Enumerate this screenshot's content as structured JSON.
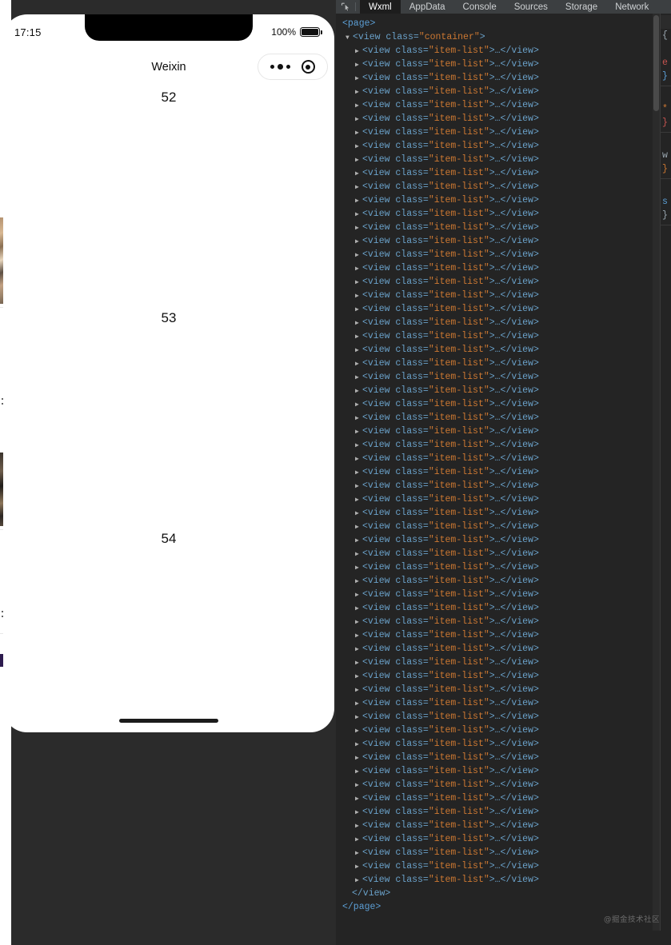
{
  "simulator": {
    "status_bar": {
      "time": "17:15",
      "battery_percent": "100%",
      "battery_icon": "battery-full-icon"
    },
    "navbar": {
      "title": "Weixin",
      "capsule": {
        "menu_icon": "more-dots-icon",
        "target_icon": "target-circle-icon"
      }
    },
    "page": {
      "items": [
        {
          "label": "52"
        },
        {
          "label": "53"
        },
        {
          "label": "54"
        }
      ]
    },
    "home_indicator": "home-indicator"
  },
  "devtools": {
    "toolbar": {
      "inspect_icon": "inspect-element-icon"
    },
    "tabs": [
      {
        "label": "Wxml",
        "active": true
      },
      {
        "label": "AppData",
        "active": false
      },
      {
        "label": "Console",
        "active": false
      },
      {
        "label": "Sources",
        "active": false
      },
      {
        "label": "Storage",
        "active": false
      },
      {
        "label": "Network",
        "active": false
      }
    ],
    "wxml": {
      "root_open": "<page>",
      "root_close": "</page>",
      "container_open_pre": "<view class=",
      "container_class": "\"container\"",
      "container_open_post": ">",
      "container_close": "</view>",
      "child_pre": "<view class=",
      "child_class": "\"item-list\"",
      "child_post": ">…</view>",
      "child_count": 62,
      "collapsed_arrow": "▶",
      "expanded_arrow": "▼"
    },
    "styles_panel": {
      "visible_fragment": true,
      "lines": [
        "",
        "{",
        "",
        "e",
        "}",
        "",
        "*",
        "}",
        "",
        "w",
        "}",
        "",
        "s",
        "}"
      ]
    },
    "watermark": "@掘金技术社区"
  },
  "colors": {
    "devtools_bg": "#242424",
    "tab_bar_bg": "#3c3f41",
    "active_tab_bg": "#1d1d1d",
    "tag_blue": "#6aa1c9",
    "value_orange": "#cc7832",
    "desktop_bg": "#2b2b2b",
    "phone_bg": "#ffffff"
  }
}
